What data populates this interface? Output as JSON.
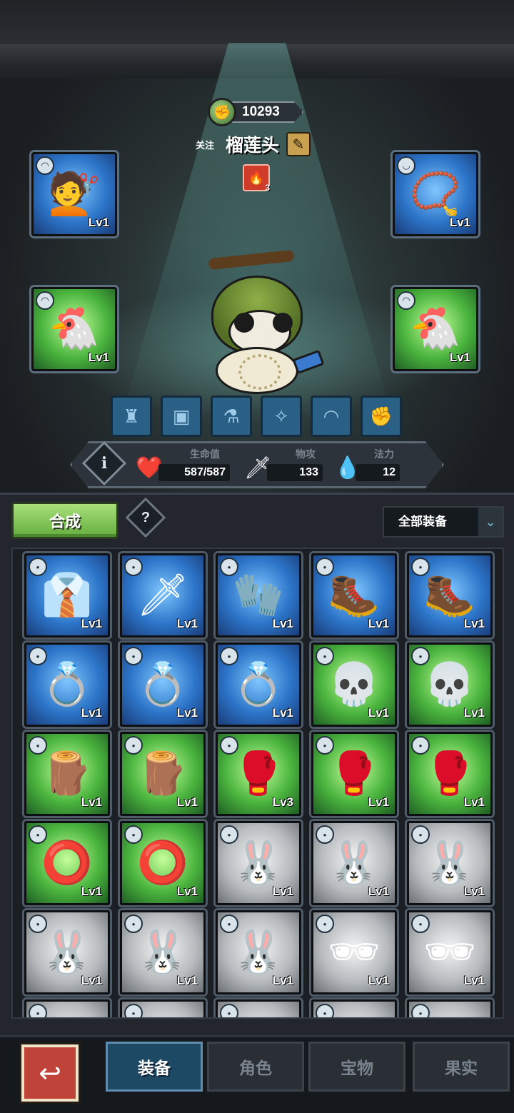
{
  "player": {
    "currency": "10293",
    "follow_label": "关注",
    "nickname": "榴莲头",
    "badge_count": "3"
  },
  "equipped_slots": [
    {
      "item": "blue-wig",
      "rarity": "blue",
      "level": "Lv1"
    },
    {
      "item": "golden-necklace",
      "rarity": "blue",
      "level": "Lv1"
    },
    {
      "item": "chicken-hat",
      "rarity": "green",
      "level": "Lv1"
    },
    {
      "item": "chicken-hat",
      "rarity": "green",
      "level": "Lv1"
    }
  ],
  "stats": {
    "hp_label": "生命值",
    "hp_value": "587/587",
    "atk_label": "物攻",
    "atk_value": "133",
    "mp_label": "法力",
    "mp_value": "12"
  },
  "toolbar": {
    "merge_label": "合成",
    "help_label": "?",
    "filter_label": "全部装备"
  },
  "inventory": [
    {
      "item": "black-suit",
      "rarity": "blue",
      "level": "Lv1",
      "icon": "👔"
    },
    {
      "item": "sword",
      "rarity": "blue",
      "level": "Lv1",
      "icon": "🗡"
    },
    {
      "item": "paw-glove",
      "rarity": "blue",
      "level": "Lv1",
      "icon": "🧤"
    },
    {
      "item": "claw-boots",
      "rarity": "blue",
      "level": "Lv1",
      "icon": "🥾"
    },
    {
      "item": "claw-boots",
      "rarity": "blue",
      "level": "Lv1",
      "icon": "🥾"
    },
    {
      "item": "purple-ring",
      "rarity": "blue",
      "level": "Lv1",
      "icon": "💍"
    },
    {
      "item": "purple-ring",
      "rarity": "blue",
      "level": "Lv1",
      "icon": "💍"
    },
    {
      "item": "purple-ring",
      "rarity": "blue",
      "level": "Lv1",
      "icon": "💍"
    },
    {
      "item": "skull-mask",
      "rarity": "green",
      "level": "Lv1",
      "icon": "💀"
    },
    {
      "item": "skull-mask",
      "rarity": "green",
      "level": "Lv1",
      "icon": "💀"
    },
    {
      "item": "branch-staff",
      "rarity": "green",
      "level": "Lv1",
      "icon": "🪵"
    },
    {
      "item": "branch-staff",
      "rarity": "green",
      "level": "Lv1",
      "icon": "🪵"
    },
    {
      "item": "boxing-glove",
      "rarity": "green",
      "level": "Lv3",
      "icon": "🥊"
    },
    {
      "item": "boxing-glove",
      "rarity": "green",
      "level": "Lv1",
      "icon": "🥊"
    },
    {
      "item": "boxing-glove",
      "rarity": "green",
      "level": "Lv1",
      "icon": "🥊"
    },
    {
      "item": "bronze-ring",
      "rarity": "green",
      "level": "Lv1",
      "icon": "⭕"
    },
    {
      "item": "bronze-ring",
      "rarity": "green",
      "level": "Lv1",
      "icon": "⭕"
    },
    {
      "item": "bunny-hat",
      "rarity": "white",
      "level": "Lv1",
      "icon": "🐰"
    },
    {
      "item": "bunny-hat",
      "rarity": "white",
      "level": "Lv1",
      "icon": "🐰"
    },
    {
      "item": "bunny-hat",
      "rarity": "white",
      "level": "Lv1",
      "icon": "🐰"
    },
    {
      "item": "bunny-hat",
      "rarity": "white",
      "level": "Lv1",
      "icon": "🐰"
    },
    {
      "item": "bunny-hat",
      "rarity": "white",
      "level": "Lv1",
      "icon": "🐰"
    },
    {
      "item": "bunny-hat",
      "rarity": "white",
      "level": "Lv1",
      "icon": "🐰"
    },
    {
      "item": "sunglasses",
      "rarity": "white",
      "level": "Lv1",
      "icon": "🕶"
    },
    {
      "item": "sunglasses",
      "rarity": "white",
      "level": "Lv1",
      "icon": "🕶"
    },
    {
      "item": "goggles",
      "rarity": "white",
      "level": "",
      "icon": "👓"
    },
    {
      "item": "goggles",
      "rarity": "white",
      "level": "",
      "icon": "👓"
    },
    {
      "item": "goggles",
      "rarity": "white",
      "level": "",
      "icon": "👓"
    },
    {
      "item": "goggles",
      "rarity": "white",
      "level": "",
      "icon": "👓"
    },
    {
      "item": "goggles",
      "rarity": "white",
      "level": "",
      "icon": "👓"
    }
  ],
  "nav": {
    "tabs": [
      {
        "label": "装备",
        "active": true
      },
      {
        "label": "角色",
        "active": false
      },
      {
        "label": "宝物",
        "active": false
      },
      {
        "label": "果实",
        "active": false
      }
    ]
  }
}
